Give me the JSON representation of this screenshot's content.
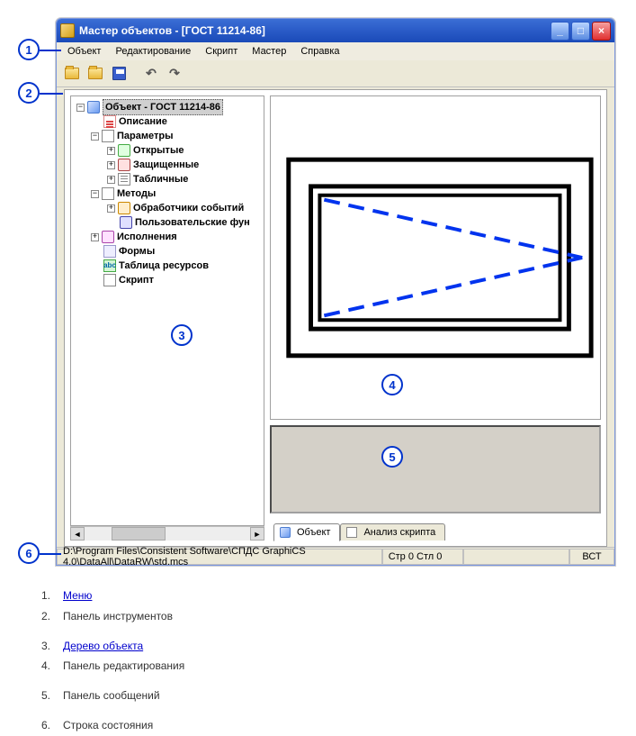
{
  "window": {
    "title": "Мастер объектов - [ГОСТ 11214-86]"
  },
  "menu": {
    "items": [
      "Объект",
      "Редактирование",
      "Скрипт",
      "Мастер",
      "Справка"
    ]
  },
  "tree": {
    "root": "Объект - ГОСТ 11214-86",
    "desc": "Описание",
    "params": "Параметры",
    "open": "Открытые",
    "protected": "Защищенные",
    "tabular": "Табличные",
    "methods": "Методы",
    "handlers": "Обработчики событий",
    "userfn": "Пользовательские фун",
    "exec": "Исполнения",
    "forms": "Формы",
    "res": "Таблица ресурсов",
    "script": "Скрипт"
  },
  "tabs": {
    "object": "Объект",
    "analysis": "Анализ скрипта"
  },
  "status": {
    "path": "D:\\Program Files\\Consistent Software\\СПДС GraphiCS 4.0\\DataAll\\DataRW\\std.mcs",
    "pos": "Стр 0 Стл 0",
    "mode": "ВСТ"
  },
  "legend": {
    "l1": "Меню",
    "l2": "Панель инструментов",
    "l3": "Дерево объекта",
    "l4": "Панель редактирования",
    "l5": "Панель сообщений",
    "l6": "Строка состояния"
  },
  "icons": {
    "res_abbr": "abc"
  }
}
